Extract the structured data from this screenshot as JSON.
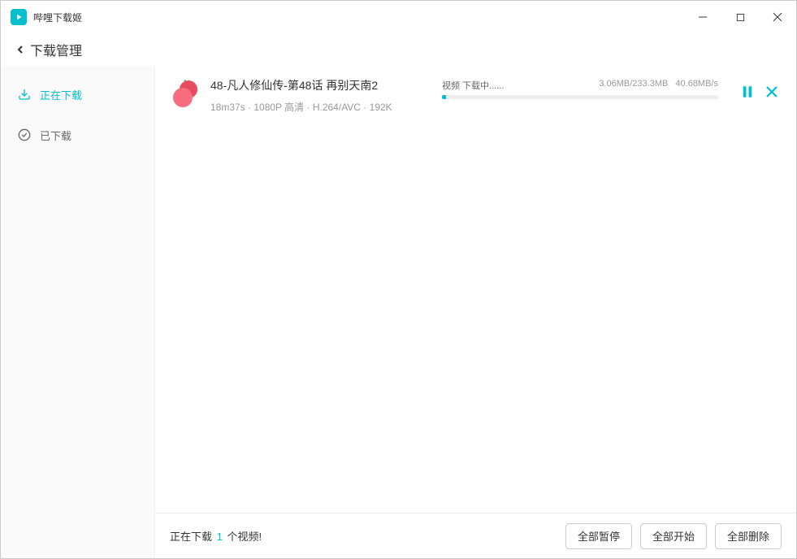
{
  "app": {
    "title": "哔哩下载姬"
  },
  "page": {
    "title": "下载管理"
  },
  "sidebar": {
    "items": [
      {
        "label": "正在下载"
      },
      {
        "label": "已下载"
      }
    ]
  },
  "downloads": [
    {
      "title": "48-凡人修仙传-第48话 再别天南2",
      "meta": "18m37s · 1080P 高清 · H.264/AVC · 192K",
      "status": "视频 下载中......",
      "size": "3.06MB/233.3MB",
      "speed": "40.68MB/s"
    }
  ],
  "footer": {
    "prefix": "正在下载 ",
    "count": "1",
    "suffix": " 个视频!",
    "buttons": {
      "pause_all": "全部暂停",
      "start_all": "全部开始",
      "delete_all": "全部删除"
    }
  }
}
